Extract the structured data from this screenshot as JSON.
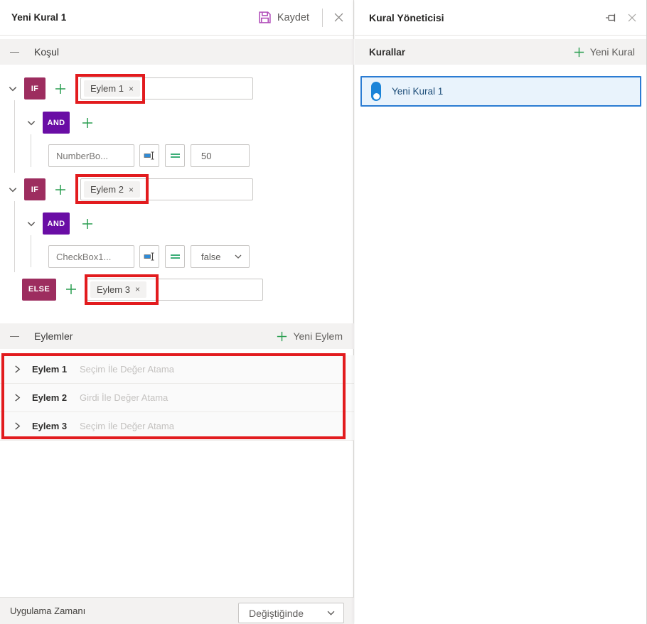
{
  "rule_editor": {
    "title": "Yeni Kural 1",
    "save_label": "Kaydet",
    "sections": {
      "condition": "Koşul",
      "actions": "Eylemler"
    },
    "new_action_label": "Yeni Eylem",
    "blocks": {
      "if1": {
        "keyword": "IF",
        "chip_label": "Eylem 1",
        "chip_remove": "×"
      },
      "and1": {
        "keyword": "AND"
      },
      "cond1": {
        "field": "NumberBo...",
        "value": "50"
      },
      "if2": {
        "keyword": "IF",
        "chip_label": "Eylem 2",
        "chip_remove": "×"
      },
      "and2": {
        "keyword": "AND"
      },
      "cond2": {
        "field": "CheckBox1...",
        "value": "false"
      },
      "else": {
        "keyword": "ELSE",
        "chip_label": "Eylem 3",
        "chip_remove": "×"
      }
    },
    "actions": [
      {
        "name": "Eylem 1",
        "type": "Seçim İle Değer Atama"
      },
      {
        "name": "Eylem 2",
        "type": "Girdi İle Değer Atama"
      },
      {
        "name": "Eylem 3",
        "type": "Seçim İle Değer Atama"
      }
    ],
    "footer": {
      "label": "Uygulama Zamanı",
      "value": "Değiştiğinde"
    }
  },
  "rule_manager": {
    "title": "Kural Yöneticisi",
    "list_header": "Kurallar",
    "new_rule_label": "Yeni Kural",
    "rules": [
      {
        "name": "Yeni Kural 1"
      }
    ]
  },
  "colors": {
    "if_else_badge": "#9d2d5f",
    "and_badge": "#6a0da5",
    "plus_green": "#2a9e50",
    "annotation_red": "#e21b1e",
    "selected_blue": "#2b7cd3",
    "save_purple": "#b14eb9"
  }
}
